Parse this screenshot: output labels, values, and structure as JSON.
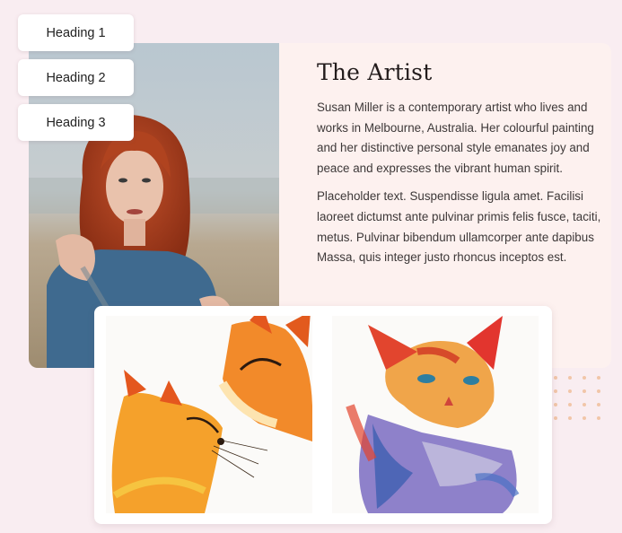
{
  "headings": [
    "Heading 1",
    "Heading 2",
    "Heading 3"
  ],
  "artist": {
    "title": "The Artist",
    "paragraph1": "Susan Miller is a contemporary artist who lives and works in Melbourne, Australia. Her colourful painting and her distinctive personal style emanates joy and peace and expresses the vibrant human spirit.",
    "paragraph2": "Placeholder text. Suspendisse ligula amet. Facilisi laoreet dictumst ante pulvinar primis felis fusce, taciti, metus. Pulvinar bibendum ullamcorper ante dapibus Massa, quis integer justo rhoncus inceptos est."
  },
  "colors": {
    "page_background": "#f9edf1",
    "card_background": "#fdf1ef",
    "dot_accent": "#f1c6a8"
  },
  "images": {
    "portrait": "woman-with-red-hair-portrait",
    "gallery_left": "watercolor-foxes",
    "gallery_right": "watercolor-cat"
  }
}
